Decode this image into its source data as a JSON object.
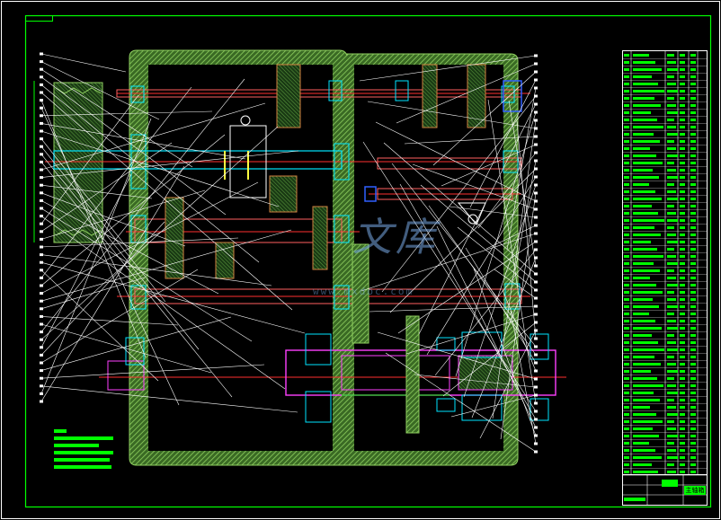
{
  "drawing": {
    "colors": {
      "background": "#000000",
      "frame": "#ffffff",
      "housing_hatch": "#7fbf4f",
      "annotation": "#00ff00",
      "shaft_red": "#ff3030",
      "part_cyan": "#00e5ff",
      "part_magenta": "#ff40ff",
      "part_yellow": "#ffff40",
      "part_blue": "#3060ff",
      "gear_orange": "#d08040"
    },
    "watermark": {
      "mark": "文库",
      "url": "www.mxdoc.com"
    },
    "title_block": {
      "name_cell": "主轴箱"
    }
  }
}
